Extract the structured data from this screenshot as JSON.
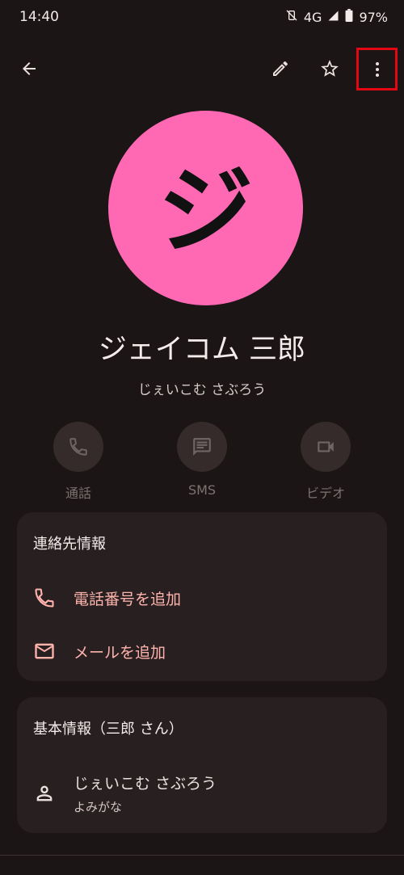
{
  "status_bar": {
    "time": "14:40",
    "network": "4G",
    "battery": "97%"
  },
  "toolbar": {
    "back_icon": "arrow-back-icon",
    "edit_icon": "pencil-icon",
    "favorite_icon": "star-outline-icon",
    "more_icon": "more-vert-icon"
  },
  "contact": {
    "avatar_letter": "ジ",
    "avatar_color": "#ff69b4",
    "name": "ジェイコム 三郎",
    "reading": "じぇいこむ さぶろう"
  },
  "actions": [
    {
      "label": "通話",
      "icon": "phone-icon"
    },
    {
      "label": "SMS",
      "icon": "message-icon"
    },
    {
      "label": "ビデオ",
      "icon": "videocam-icon"
    }
  ],
  "contact_info_card": {
    "title": "連絡先情報",
    "add_phone_label": "電話番号を追加",
    "add_email_label": "メールを追加"
  },
  "basic_info_card": {
    "title": "基本情報（三郎 さん）",
    "reading_value": "じぇいこむ さぶろう",
    "reading_caption": "よみがな"
  },
  "colors": {
    "accent": "#ffb3ad",
    "highlight": "#e30613",
    "background": "#1b1515"
  }
}
